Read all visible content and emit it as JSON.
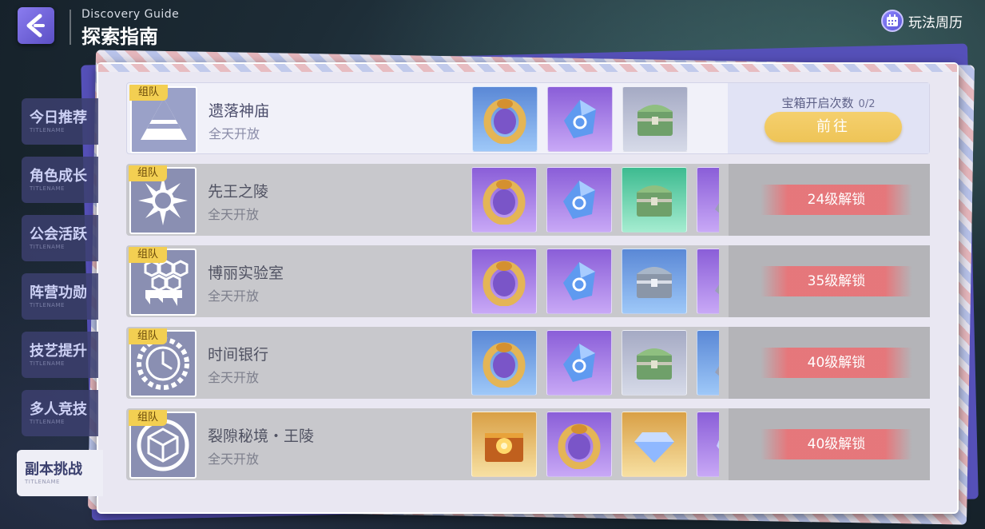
{
  "header": {
    "title_en": "Discovery Guide",
    "title_cn": "探索指南",
    "calendar_label": "玩法周历"
  },
  "sidebar": {
    "items": [
      {
        "label": "今日推荐",
        "sub": "TITLENAME",
        "active": false
      },
      {
        "label": "角色成长",
        "sub": "TITLENAME",
        "active": false
      },
      {
        "label": "公会活跃",
        "sub": "TITLENAME",
        "active": false
      },
      {
        "label": "阵营功勋",
        "sub": "TITLENAME",
        "active": false
      },
      {
        "label": "技艺提升",
        "sub": "TITLENAME",
        "active": false
      },
      {
        "label": "多人竞技",
        "sub": "TITLENAME",
        "active": false
      },
      {
        "label": "副本挑战",
        "sub": "TITLENAME",
        "active": true
      }
    ]
  },
  "rows": [
    {
      "tag": "组队",
      "name": "遗落神庙",
      "status": "全天开放",
      "icon": "pyramid-icon",
      "rewards": [
        "ring-icon",
        "crystal-icon",
        "chest-icon"
      ],
      "chest_label": "宝箱开启次数",
      "chest_count": "0/2",
      "action": "前往",
      "unlocked": true
    },
    {
      "tag": "组队",
      "name": "先王之陵",
      "status": "全天开放",
      "icon": "sun-icon",
      "rewards": [
        "ring-icon",
        "crystal-icon",
        "chest-icon",
        "ore-icon"
      ],
      "lock_label": "24级解锁",
      "unlocked": false
    },
    {
      "tag": "组队",
      "name": "博丽实验室",
      "status": "全天开放",
      "icon": "hexagon-icon",
      "rewards": [
        "ring-icon",
        "crystal-icon",
        "chest-icon",
        "ore-icon"
      ],
      "lock_label": "35级解锁",
      "unlocked": false
    },
    {
      "tag": "组队",
      "name": "时间银行",
      "status": "全天开放",
      "icon": "clock-icon",
      "rewards": [
        "ring-icon",
        "crystal-icon",
        "chest-icon",
        "ore-icon"
      ],
      "lock_label": "40级解锁",
      "unlocked": false
    },
    {
      "tag": "组队",
      "name": "裂隙秘境・王陵",
      "status": "全天开放",
      "icon": "cube-icon",
      "rewards": [
        "golden-chest-icon",
        "ring-icon",
        "diamond-icon",
        "shard-icon"
      ],
      "lock_label": "40级解锁",
      "unlocked": false
    }
  ]
}
